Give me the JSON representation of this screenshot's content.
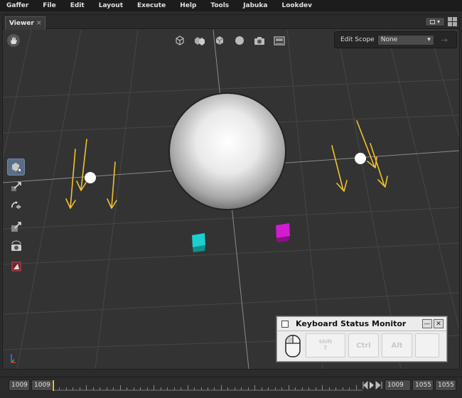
{
  "menubar": {
    "items": [
      "Gaffer",
      "File",
      "Edit",
      "Layout",
      "Execute",
      "Help",
      "Tools",
      "Jabuka",
      "Lookdev"
    ]
  },
  "tabs": [
    {
      "label": "Viewer",
      "close": "×"
    }
  ],
  "tabbar_controls": {
    "layout_button": "▾",
    "grid_icon": "grid-icon"
  },
  "viewer": {
    "top_tools": [
      "cube-wireframe-icon",
      "shading-mode-icon",
      "solid-cube-icon",
      "sphere-icon",
      "camera-icon",
      "image-icon"
    ],
    "edit_scope": {
      "label": "Edit Scope",
      "value": "None",
      "arrow": "▾",
      "nav": "→"
    },
    "left_tools": [
      {
        "name": "selection-tool-icon",
        "active": true
      },
      {
        "name": "translate-tool-icon",
        "active": false
      },
      {
        "name": "rotate-tool-icon",
        "active": false
      },
      {
        "name": "scale-tool-icon",
        "active": false
      },
      {
        "name": "camera-tool-icon",
        "active": false
      },
      {
        "name": "crop-window-tool-icon",
        "active": false
      }
    ]
  },
  "keyboard_monitor": {
    "title": "Keyboard Status Monitor",
    "minimize": "—",
    "close": "✕",
    "keys": [
      "Shift",
      "Ctrl",
      "Alt",
      ""
    ]
  },
  "timeline": {
    "start_outer": "1009",
    "start_inner": "1009",
    "current": "1009",
    "end_inner": "1055",
    "end_outer": "1055"
  },
  "colors": {
    "light_arrows": "#f2c12e",
    "cube_cyan": "#1ccfd0",
    "cube_magenta": "#d21cd0",
    "active_tool": "#5a6e8a"
  }
}
